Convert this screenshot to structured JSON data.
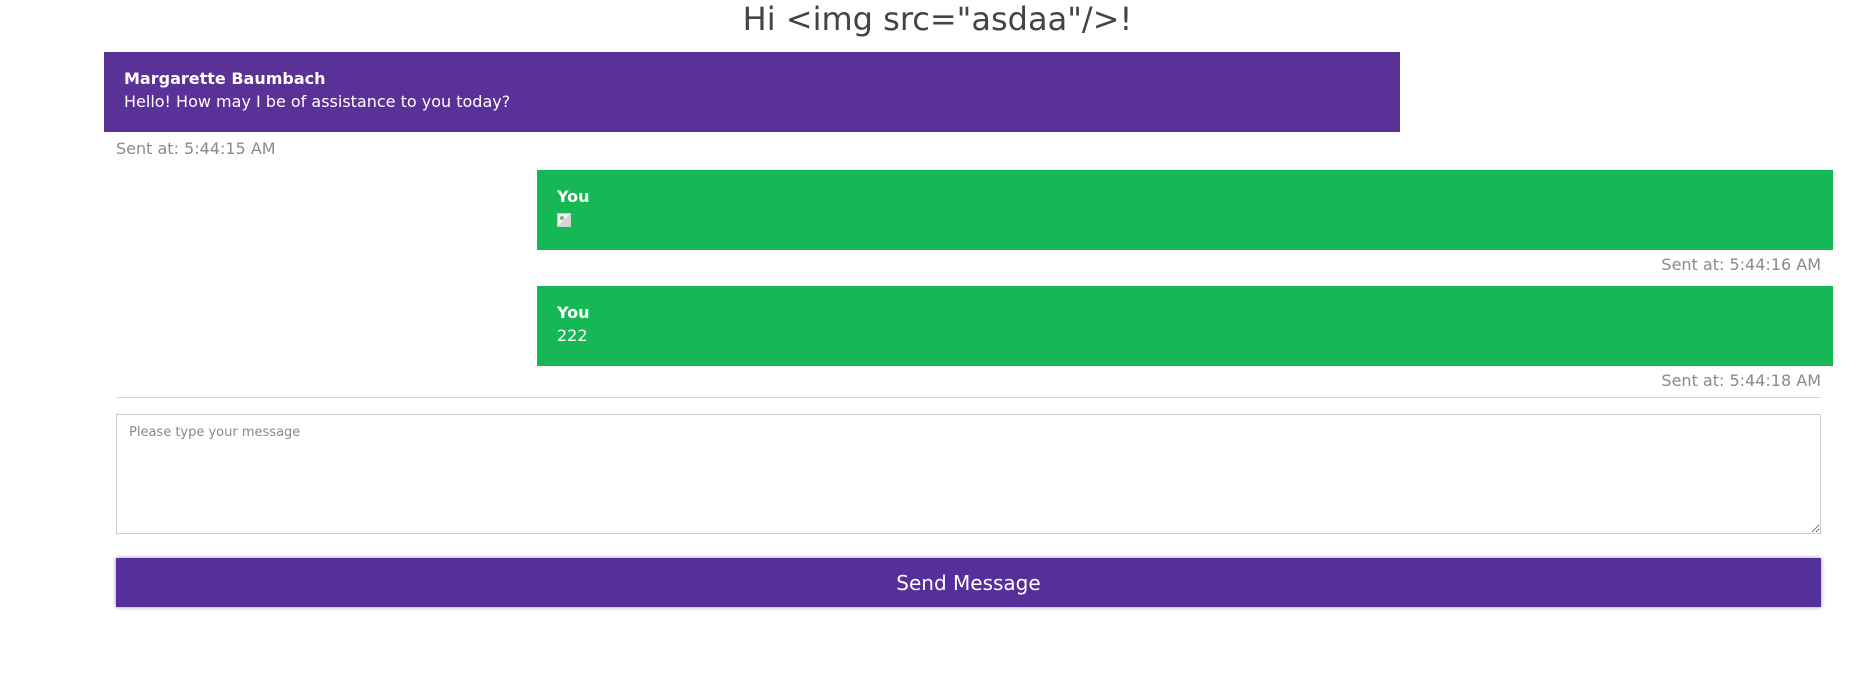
{
  "header": {
    "title": "Hi <img src=\"asdaa\"/>!"
  },
  "messages": [
    {
      "sender": "Margarette Baumbach",
      "text": "Hello! How may I be of assistance to you today?",
      "sent_at": "Sent at: 5:44:15 AM",
      "role": "agent"
    },
    {
      "sender": "You",
      "text": "",
      "content_icon": "broken-image-icon",
      "sent_at": "Sent at: 5:44:16 AM",
      "role": "user"
    },
    {
      "sender": "You",
      "text": "222",
      "sent_at": "Sent at: 5:44:18 AM",
      "role": "user"
    }
  ],
  "composer": {
    "placeholder": "Please type your message",
    "value": "",
    "send_label": "Send Message"
  },
  "colors": {
    "agent_bubble": "#5a3196",
    "user_bubble": "#16b855",
    "send_button": "#56309a",
    "timestamp": "#8a8a8a"
  }
}
